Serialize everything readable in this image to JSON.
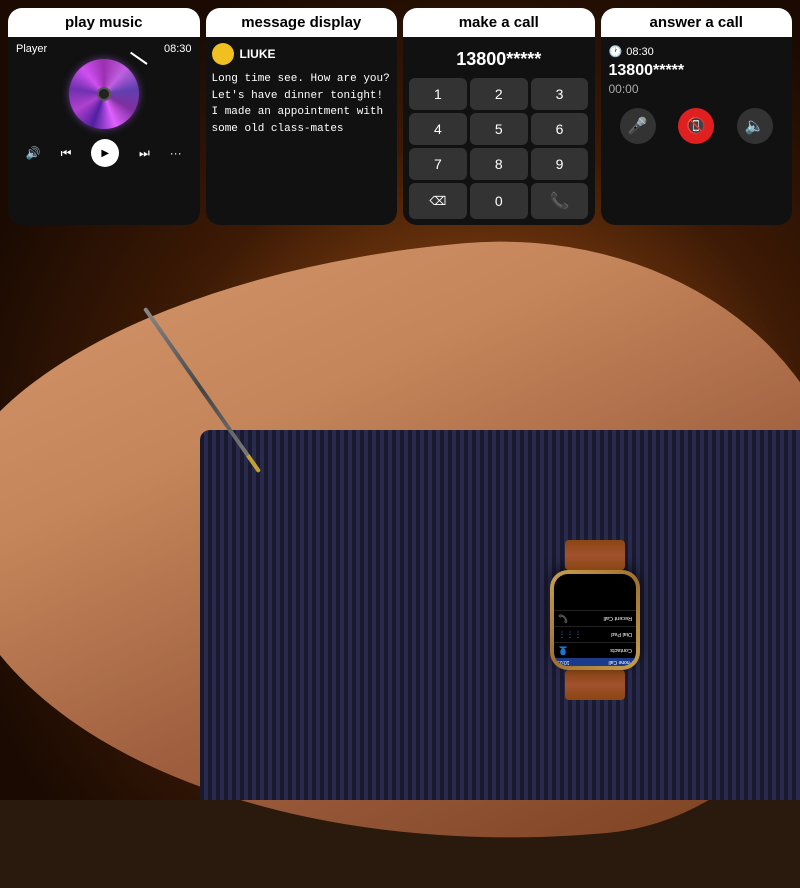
{
  "panels": {
    "music": {
      "label": "play music",
      "player_label": "Player",
      "time": "08:30",
      "controls": {
        "volume": "🔊",
        "prev": "⏮",
        "play": "▶",
        "next": "⏭",
        "more": "···"
      }
    },
    "message": {
      "label": "message display",
      "sender": "LIUKE",
      "body": "Long time see. How are you? Let's have dinner tonight! I made an appointment with some old class-mates"
    },
    "dial": {
      "label": "make a call",
      "number": "13800*****",
      "keys": [
        "1",
        "2",
        "3",
        "4",
        "5",
        "6",
        "7",
        "8",
        "9",
        "⌫",
        "0",
        "📞"
      ]
    },
    "answer": {
      "label": "answer a call",
      "time": "08:30",
      "number": "13800*****",
      "duration": "00:00",
      "buttons": {
        "mute": "🎤",
        "hangup": "📵",
        "speaker": "🔈"
      }
    }
  },
  "watch": {
    "time": "10:09",
    "title": "Phone Call",
    "menu": [
      {
        "label": "Recent Call",
        "icon": "📞"
      },
      {
        "label": "Dial Pad",
        "icon": "⋮⋮⋮"
      },
      {
        "label": "Contacts",
        "icon": "👤"
      }
    ]
  }
}
